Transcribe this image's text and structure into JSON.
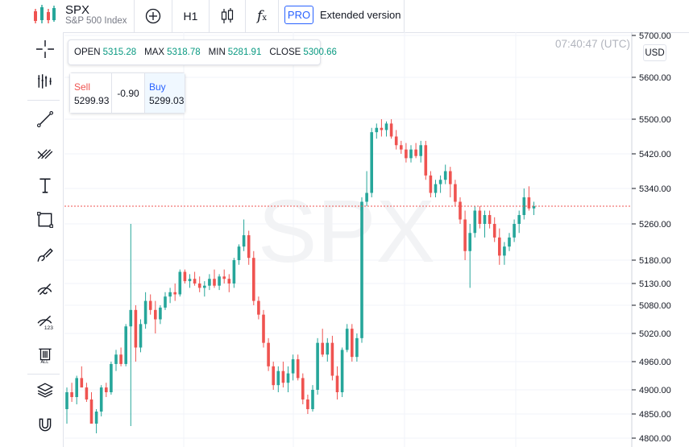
{
  "header": {
    "symbol": "SPX",
    "symbol_name": "S&P 500 Index",
    "timeframe": "H1",
    "pro_label": "PRO",
    "extended_label": "Extended version"
  },
  "ohlc": {
    "open_label": "OPEN",
    "open_value": "5315.28",
    "max_label": "MAX",
    "max_value": "5318.78",
    "min_label": "MIN",
    "min_value": "5281.91",
    "close_label": "CLOSE",
    "close_value": "5300.66"
  },
  "trade": {
    "sell_label": "Sell",
    "sell_price": "5299.93",
    "spread": "-0.90",
    "buy_label": "Buy",
    "buy_price": "5299.03"
  },
  "clock": "07:40:47 (UTC)",
  "currency": "USD",
  "watermark": "SPX",
  "colors": {
    "up": "#26a69a",
    "down": "#ef5350",
    "price_line": "#ef5350",
    "accent": "#2962ff"
  },
  "tools": [
    "crosshair-icon",
    "indicators-icon",
    "trend-line-icon",
    "pitchfork-icon",
    "text-icon",
    "rectangle-icon",
    "brush-icon",
    "hide-drawings-icon",
    "measure-icon",
    "delete-all-icon",
    "layers-icon",
    "magnet-icon"
  ],
  "chart_data": {
    "type": "candlestick",
    "y_ticks": [
      5700,
      5600,
      5500,
      5420,
      5340,
      5260,
      5180,
      5130,
      5080,
      5020,
      4960,
      4900,
      4850,
      4800
    ],
    "y_tick_labels": [
      "5700.00",
      "5600.00",
      "5500.00",
      "5420.00",
      "5340.00",
      "5260.00",
      "5180.00",
      "5130.00",
      "5080.00",
      "5020.00",
      "4960.00",
      "4900.00",
      "4850.00",
      "4800.00"
    ],
    "current_price": 5300,
    "candles": [
      [
        4860,
        4905,
        4830,
        4895
      ],
      [
        4895,
        4915,
        4875,
        4885
      ],
      [
        4885,
        4930,
        4870,
        4925
      ],
      [
        4925,
        4950,
        4905,
        4905
      ],
      [
        4905,
        4915,
        4875,
        4880
      ],
      [
        4880,
        4895,
        4830,
        4830
      ],
      [
        4830,
        4860,
        4810,
        4855
      ],
      [
        4855,
        4910,
        4845,
        4905
      ],
      [
        4905,
        4915,
        4885,
        4895
      ],
      [
        4895,
        4960,
        4890,
        4955
      ],
      [
        4955,
        4985,
        4940,
        4975
      ],
      [
        4975,
        4990,
        4950,
        4955
      ],
      [
        4955,
        5040,
        4950,
        5035
      ],
      [
        5035,
        5260,
        4825,
        5070
      ],
      [
        5070,
        5080,
        4960,
        4990
      ],
      [
        4990,
        5050,
        4980,
        5040
      ],
      [
        5040,
        5110,
        5030,
        5090
      ],
      [
        5090,
        5105,
        5060,
        5070
      ],
      [
        5070,
        5090,
        5020,
        5050
      ],
      [
        5050,
        5080,
        5040,
        5075
      ],
      [
        5075,
        5110,
        5070,
        5100
      ],
      [
        5100,
        5120,
        5085,
        5110
      ],
      [
        5110,
        5130,
        5090,
        5105
      ],
      [
        5105,
        5160,
        5100,
        5155
      ],
      [
        5155,
        5160,
        5130,
        5135
      ],
      [
        5135,
        5150,
        5120,
        5140
      ],
      [
        5140,
        5155,
        5125,
        5130
      ],
      [
        5130,
        5145,
        5110,
        5120
      ],
      [
        5120,
        5135,
        5100,
        5125
      ],
      [
        5125,
        5150,
        5115,
        5140
      ],
      [
        5140,
        5160,
        5120,
        5125
      ],
      [
        5125,
        5150,
        5115,
        5145
      ],
      [
        5145,
        5160,
        5130,
        5140
      ],
      [
        5140,
        5150,
        5110,
        5130
      ],
      [
        5130,
        5185,
        5120,
        5180
      ],
      [
        5180,
        5215,
        5170,
        5210
      ],
      [
        5210,
        5270,
        5200,
        5235
      ],
      [
        5235,
        5245,
        5170,
        5185
      ],
      [
        5185,
        5200,
        5080,
        5090
      ],
      [
        5090,
        5100,
        5050,
        5060
      ],
      [
        5060,
        5070,
        4990,
        5000
      ],
      [
        5000,
        5010,
        4940,
        4950
      ],
      [
        4950,
        4960,
        4900,
        4910
      ],
      [
        4910,
        4950,
        4895,
        4940
      ],
      [
        4940,
        4960,
        4905,
        4915
      ],
      [
        4915,
        4950,
        4895,
        4935
      ],
      [
        4935,
        4975,
        4920,
        4965
      ],
      [
        4965,
        4975,
        4920,
        4925
      ],
      [
        4925,
        4935,
        4870,
        4880
      ],
      [
        4880,
        4890,
        4850,
        4860
      ],
      [
        4860,
        4910,
        4855,
        4900
      ],
      [
        4900,
        5010,
        4890,
        5000
      ],
      [
        5000,
        5030,
        4970,
        4975
      ],
      [
        4975,
        5010,
        4960,
        5000
      ],
      [
        5000,
        5015,
        4920,
        4930
      ],
      [
        4930,
        4950,
        4880,
        4895
      ],
      [
        4895,
        4990,
        4885,
        4985
      ],
      [
        4985,
        5040,
        4980,
        5030
      ],
      [
        5030,
        5040,
        4960,
        4970
      ],
      [
        4970,
        5020,
        4960,
        5010
      ],
      [
        5010,
        5320,
        5000,
        5310
      ],
      [
        5310,
        5380,
        5300,
        5330
      ],
      [
        5330,
        5480,
        5320,
        5470
      ],
      [
        5470,
        5490,
        5455,
        5480
      ],
      [
        5480,
        5500,
        5460,
        5475
      ],
      [
        5475,
        5495,
        5460,
        5490
      ],
      [
        5490,
        5500,
        5455,
        5460
      ],
      [
        5460,
        5475,
        5430,
        5440
      ],
      [
        5440,
        5450,
        5420,
        5430
      ],
      [
        5430,
        5445,
        5400,
        5410
      ],
      [
        5410,
        5440,
        5400,
        5430
      ],
      [
        5430,
        5445,
        5410,
        5415
      ],
      [
        5415,
        5450,
        5400,
        5440
      ],
      [
        5440,
        5450,
        5360,
        5370
      ],
      [
        5370,
        5380,
        5320,
        5330
      ],
      [
        5330,
        5360,
        5320,
        5350
      ],
      [
        5350,
        5370,
        5330,
        5360
      ],
      [
        5360,
        5395,
        5350,
        5380
      ],
      [
        5380,
        5390,
        5320,
        5350
      ],
      [
        5350,
        5360,
        5300,
        5310
      ],
      [
        5310,
        5320,
        5260,
        5270
      ],
      [
        5270,
        5290,
        5180,
        5200
      ],
      [
        5200,
        5260,
        5120,
        5240
      ],
      [
        5240,
        5300,
        5230,
        5290
      ],
      [
        5290,
        5300,
        5250,
        5260
      ],
      [
        5260,
        5290,
        5230,
        5280
      ],
      [
        5280,
        5290,
        5250,
        5260
      ],
      [
        5260,
        5275,
        5220,
        5230
      ],
      [
        5230,
        5250,
        5170,
        5190
      ],
      [
        5190,
        5220,
        5170,
        5210
      ],
      [
        5210,
        5240,
        5200,
        5230
      ],
      [
        5230,
        5270,
        5220,
        5260
      ],
      [
        5260,
        5290,
        5240,
        5280
      ],
      [
        5280,
        5340,
        5270,
        5320
      ],
      [
        5320,
        5345,
        5290,
        5295
      ],
      [
        5295,
        5310,
        5280,
        5300
      ]
    ]
  }
}
